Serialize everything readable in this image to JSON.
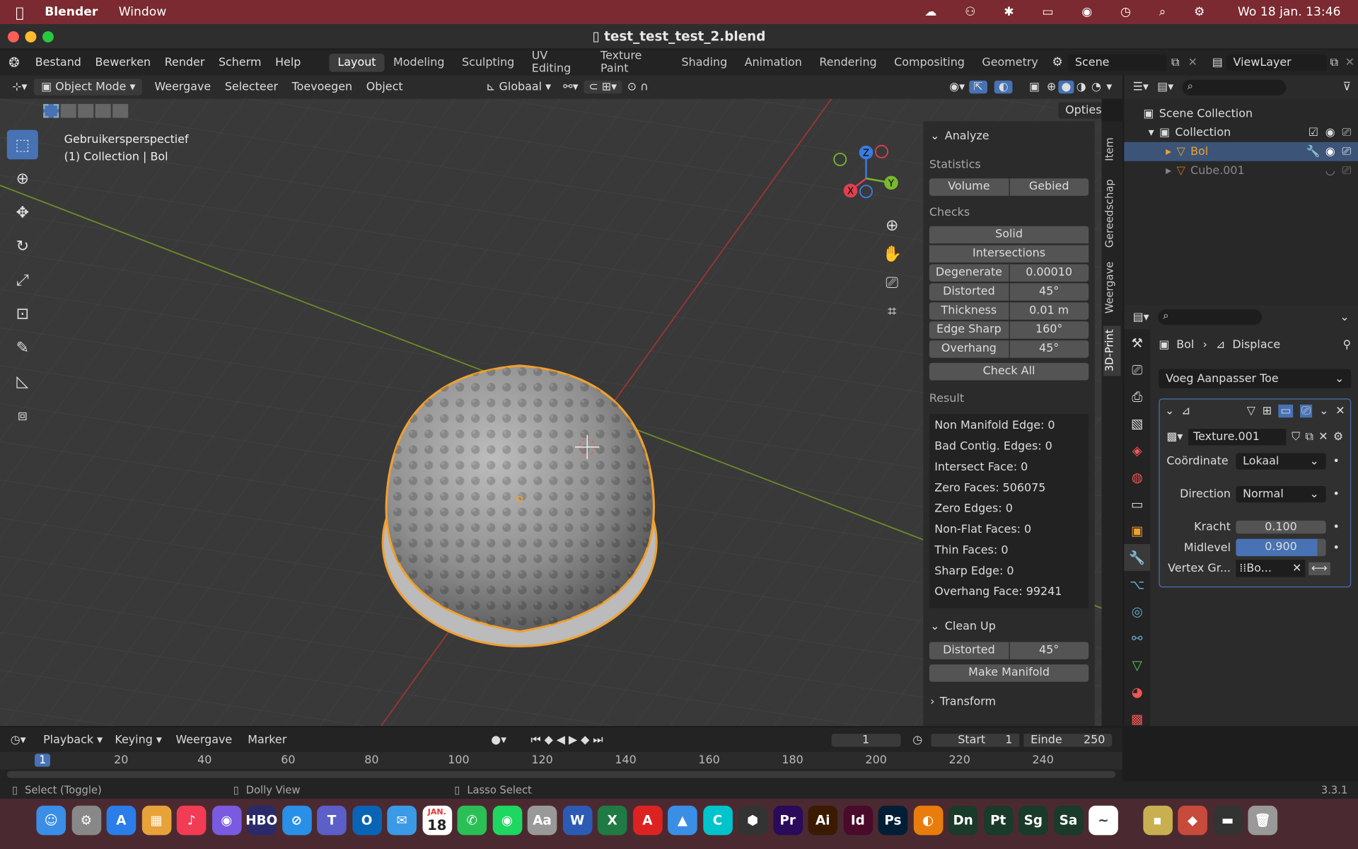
{
  "menubar": {
    "app": "Blender",
    "menu": [
      "Window"
    ],
    "clock": "Wo 18 jan.  13:46"
  },
  "window": {
    "title": "test_test_test_2.blend"
  },
  "topbar": {
    "menus": [
      "Bestand",
      "Bewerken",
      "Render",
      "Scherm",
      "Help"
    ],
    "tabs": [
      "Layout",
      "Modeling",
      "Sculpting",
      "UV Editing",
      "Texture Paint",
      "Shading",
      "Animation",
      "Rendering",
      "Compositing",
      "Geometry"
    ],
    "scene": "Scene",
    "viewlayer": "ViewLayer"
  },
  "viewport_header": {
    "mode": "Object Mode",
    "menus": [
      "Weergave",
      "Selecteer",
      "Toevoegen",
      "Object"
    ],
    "orientation": "Globaal",
    "options": "Opties"
  },
  "viewport": {
    "perspective": "Gebruikersperspectief",
    "collection": "(1) Collection | Bol",
    "gizmo": {
      "z": "Z",
      "y": "Y",
      "x": "X"
    }
  },
  "analyze": {
    "title": "Analyze",
    "statistics": "Statistics",
    "volume": "Volume",
    "gebied": "Gebied",
    "checks": "Checks",
    "solid": "Solid",
    "intersections": "Intersections",
    "params": [
      {
        "label": "Degenerate",
        "value": "0.00010"
      },
      {
        "label": "Distorted",
        "value": "45°"
      },
      {
        "label": "Thickness",
        "value": "0.01 m"
      },
      {
        "label": "Edge Sharp",
        "value": "160°"
      },
      {
        "label": "Overhang",
        "value": "45°"
      }
    ],
    "check_all": "Check All",
    "result": "Result",
    "results": [
      "Non Manifold Edge: 0",
      "Bad Contig. Edges: 0",
      "Intersect Face: 0",
      "Zero Faces: 506075",
      "Zero Edges: 0",
      "Non-Flat Faces: 0",
      "Thin Faces: 0",
      "Sharp Edge: 0",
      "Overhang Face: 99241"
    ]
  },
  "cleanup": {
    "title": "Clean Up",
    "distorted": "Distorted",
    "distorted_value": "45°",
    "make_manifold": "Make Manifold",
    "transform": "Transform"
  },
  "ntabs": {
    "item": "Item",
    "tool": "Gereedschap",
    "view": "Weergave",
    "print": "3D-Print"
  },
  "outliner": {
    "scene_collection": "Scene Collection",
    "collection": "Collection",
    "objects": [
      "Bol",
      "Cube.001"
    ]
  },
  "properties": {
    "object": "Bol",
    "modifier_breadcrumb": "Displace",
    "add_modifier": "Voeg Aanpasser Toe",
    "texture": "Texture.001",
    "fields": [
      {
        "label": "Coördinate",
        "value": "Lokaal"
      },
      {
        "label": "Direction",
        "value": "Normal"
      }
    ],
    "kracht_label": "Kracht",
    "kracht": "0.100",
    "midlevel_label": "Midlevel",
    "midlevel": "0.900",
    "midlevel_fraction": 0.9,
    "vertex_label": "Vertex Gr...",
    "vertex_value": "Bo..."
  },
  "timeline": {
    "menus": [
      "Playback",
      "Keying",
      "Weergave",
      "Marker"
    ],
    "frame": "1",
    "start_label": "Start",
    "start": "1",
    "end_label": "Einde",
    "end": "250",
    "ticks": [
      "1",
      "20",
      "40",
      "60",
      "80",
      "100",
      "120",
      "140",
      "160",
      "180",
      "200",
      "220",
      "240"
    ]
  },
  "status": {
    "select": "Select (Toggle)",
    "dolly": "Dolly View",
    "lasso": "Lasso Select",
    "version": "3.3.1"
  },
  "dock": {
    "apps": [
      "Finder",
      "Settings",
      "App Store",
      "Launchpad",
      "Music",
      "Siri",
      "HBO max",
      "Safari",
      "Teams",
      "Outlook",
      "Mail",
      "Calendar",
      "WhatsApp",
      "Spotify",
      "Font Book",
      "Word",
      "Excel",
      "Acrobat",
      "Keynote",
      "Canva",
      "Nord",
      "Pr",
      "Ai",
      "Id",
      "Ps",
      "Blender",
      "Dn",
      "Pt",
      "Sg",
      "Sa",
      "Freeform",
      "Sonos",
      "Affinity",
      "Screen",
      "Trash"
    ],
    "calendar_day": "18",
    "calendar_month": "JAN."
  }
}
